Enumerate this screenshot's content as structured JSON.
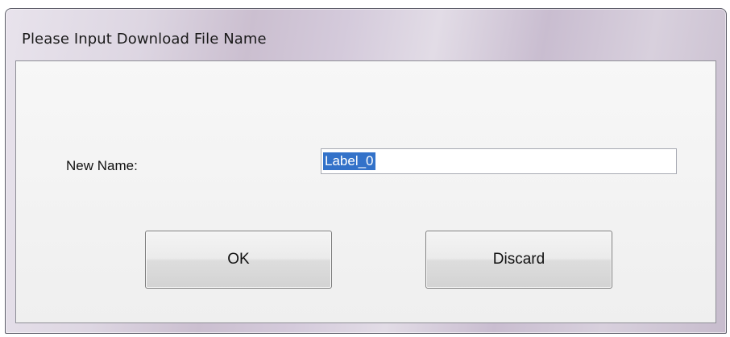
{
  "dialog": {
    "title": "Please Input Download File Name"
  },
  "form": {
    "label": "New Name:",
    "value": "Label_0"
  },
  "buttons": {
    "ok_label": "OK",
    "discard_label": "Discard"
  }
}
